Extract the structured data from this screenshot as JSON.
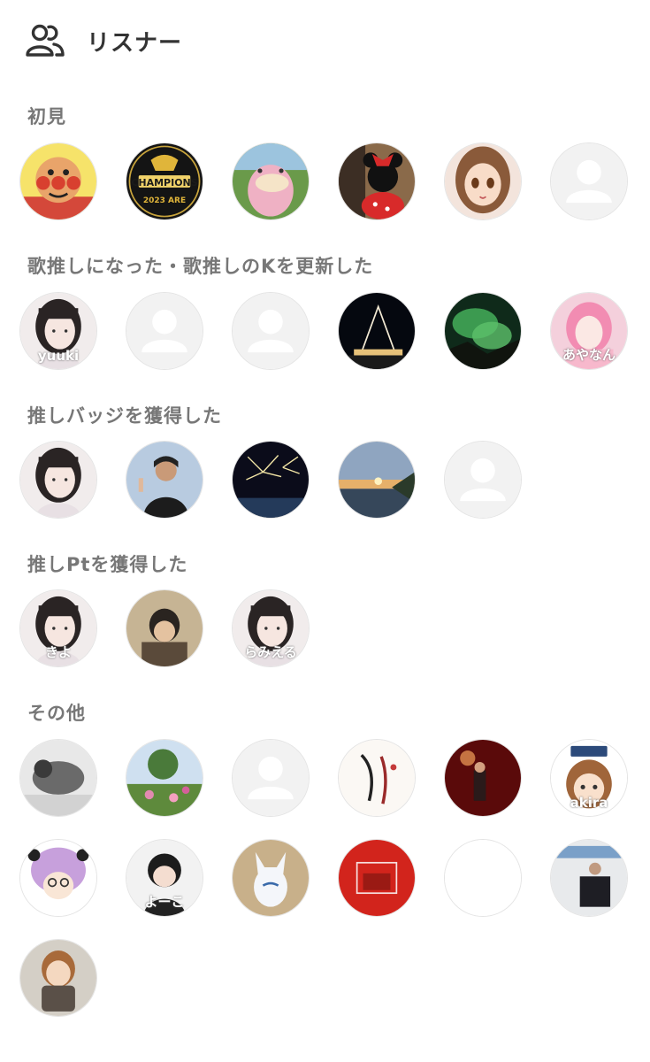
{
  "header": {
    "title": "リスナー",
    "icon": "users-icon"
  },
  "sections": [
    {
      "label": "初見",
      "avatars": [
        {
          "name": "anpanman-avatar",
          "icon": "anpanman-face-icon"
        },
        {
          "name": "tigers-champions-avatar",
          "icon": "tigers-logo-icon",
          "text": "CHAMPIONS",
          "text2": "2023 ARE"
        },
        {
          "name": "slowpoke-avatar",
          "icon": "slowpoke-figure-icon"
        },
        {
          "name": "minnie-avatar",
          "icon": "minnie-mouse-icon"
        },
        {
          "name": "anime-girl-avatar",
          "icon": "anime-girl-icon"
        },
        {
          "name": "default-user-avatar",
          "icon": "default-person-icon"
        }
      ]
    },
    {
      "label": "歌推しになった・歌推しのKを更新した",
      "avatars": [
        {
          "name": "yuuki-avatar",
          "icon": "woman-photo-icon",
          "text": "yuuki"
        },
        {
          "name": "default-user-avatar",
          "icon": "default-person-icon"
        },
        {
          "name": "default-user-avatar",
          "icon": "default-person-icon"
        },
        {
          "name": "night-building-avatar",
          "icon": "night-building-photo-icon"
        },
        {
          "name": "aurora-avatar",
          "icon": "aurora-photo-icon"
        },
        {
          "name": "ayanan-avatar",
          "icon": "pink-hair-girl-icon",
          "text": "あやなん"
        }
      ]
    },
    {
      "label": "推しバッジを獲得した",
      "avatars": [
        {
          "name": "woman-photo-avatar",
          "icon": "woman-photo-icon"
        },
        {
          "name": "man-peace-avatar",
          "icon": "man-peace-photo-icon"
        },
        {
          "name": "fireworks-avatar",
          "icon": "fireworks-photo-icon"
        },
        {
          "name": "sunset-avatar",
          "icon": "sunset-photo-icon"
        },
        {
          "name": "default-user-avatar",
          "icon": "default-person-icon"
        }
      ]
    },
    {
      "label": "推しPtを獲得した",
      "avatars": [
        {
          "name": "kiyo-avatar",
          "icon": "woman-photo-icon",
          "text": "きよ"
        },
        {
          "name": "peace-sign-avatar",
          "icon": "peace-sign-photo-icon"
        },
        {
          "name": "mie-avatar",
          "icon": "woman-photo-icon",
          "text": "らみえる"
        }
      ]
    },
    {
      "label": "その他",
      "avatars": [
        {
          "name": "dog-avatar",
          "icon": "dog-photo-icon"
        },
        {
          "name": "garden-avatar",
          "icon": "garden-photo-icon"
        },
        {
          "name": "default-user-avatar",
          "icon": "default-person-icon"
        },
        {
          "name": "illustration-avatar",
          "icon": "ink-illustration-icon"
        },
        {
          "name": "concert-avatar",
          "icon": "concert-photo-icon"
        },
        {
          "name": "akira-avatar",
          "icon": "chibi-girl-icon",
          "text": "akira"
        },
        {
          "name": "purple-hair-avatar",
          "icon": "purple-hair-cartoon-icon"
        },
        {
          "name": "yoko-avatar",
          "icon": "baby-photo-icon",
          "text": "よーこ"
        },
        {
          "name": "fox-figurine-avatar",
          "icon": "fox-figurine-icon"
        },
        {
          "name": "red-box-avatar",
          "icon": "red-box-photo-icon"
        },
        {
          "name": "blank-avatar",
          "icon": "blank-icon"
        },
        {
          "name": "magazine-man-avatar",
          "icon": "magazine-cover-icon"
        },
        {
          "name": "doll-avatar",
          "icon": "doll-figure-icon"
        }
      ]
    }
  ],
  "colors": {
    "page_bg": "#ffffff",
    "title_text": "#333333",
    "section_label": "#777777",
    "default_avatar_bg": "#f2f2f2",
    "default_avatar_figure": "#ffffff",
    "avatar_border": "#e4e4e4"
  }
}
